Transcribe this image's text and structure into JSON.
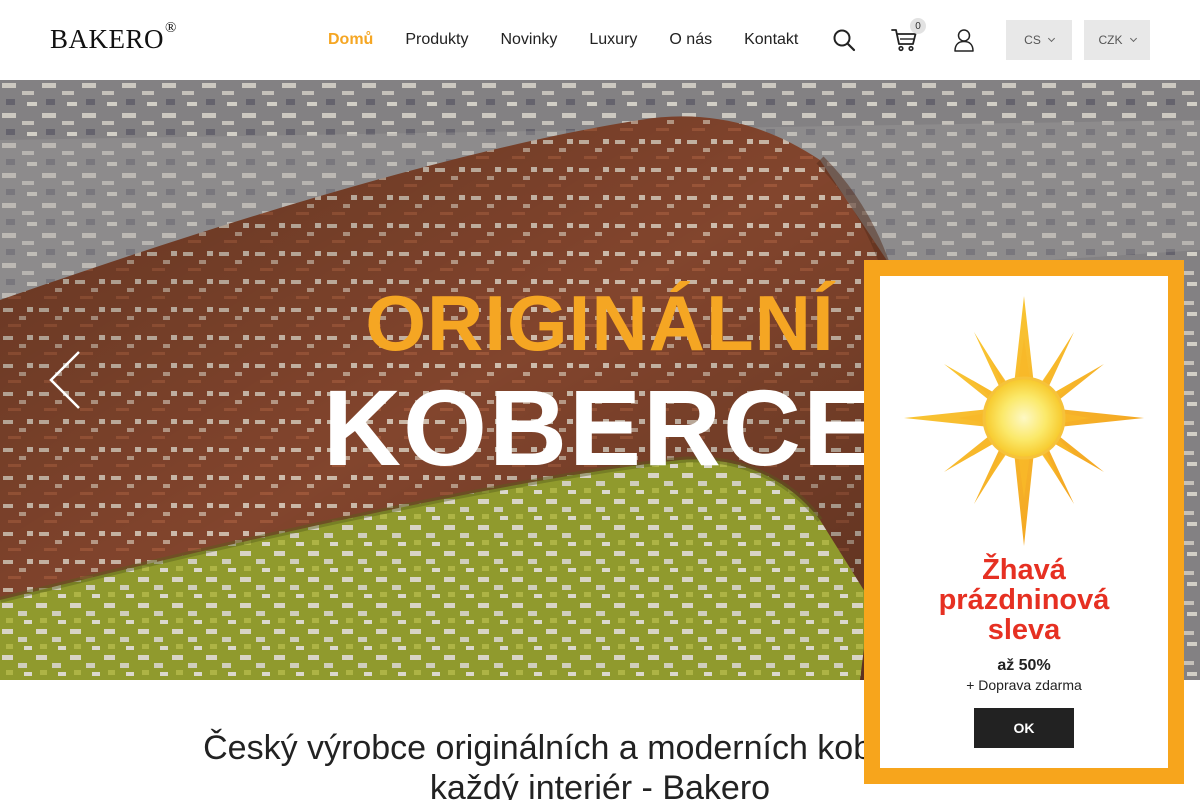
{
  "header": {
    "logo": "BAKERO",
    "logo_mark": "®",
    "nav": [
      {
        "label": "Domů",
        "active": true
      },
      {
        "label": "Produkty"
      },
      {
        "label": "Novinky"
      },
      {
        "label": "Luxury"
      },
      {
        "label": "O nás"
      },
      {
        "label": "Kontakt"
      }
    ],
    "cart_count": "0",
    "language": "CS",
    "currency": "CZK",
    "icons": [
      "search-icon",
      "cart-icon",
      "user-icon",
      "chevron-down-icon"
    ]
  },
  "hero": {
    "title_line1": "ORIGINÁLNÍ",
    "title_line2": "KOBERCE",
    "accent_color": "#f5a623"
  },
  "intro": {
    "line1": "Český výrobce originálních a moderních koberců pro",
    "line2": "každý interiér - Bakero"
  },
  "popup": {
    "title_line1": "Žhavá",
    "title_line2": "prázdninová",
    "title_line3": "sleva",
    "discount": "až 50%",
    "shipping": "+ Doprava zdarma",
    "ok_label": "OK",
    "border_color": "#f7a51c",
    "title_color": "#e63022"
  }
}
